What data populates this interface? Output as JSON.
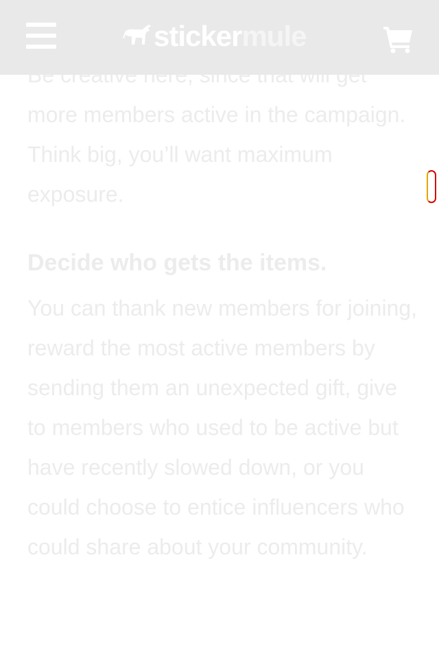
{
  "header": {
    "menu_icon": "hamburger-menu-icon",
    "logo": {
      "word_part1": "sticker",
      "word_part2": "mule",
      "icon": "mule-logo-icon"
    },
    "cart_icon": "shopping-cart-icon"
  },
  "article": {
    "paragraph_1": "Be creative here, since that will get more members active in the campaign. Think big, you’ll want maximum exposure.",
    "heading": "Decide who gets the items.",
    "paragraph_2": "You can thank new members for joining, reward the most active members by sending them an unexpected gift, give to members who used to be active but have recently slowed down, or you could choose to entice influencers who could share about your community."
  },
  "colors": {
    "header_bg": "#e9e9e9",
    "text_faded": "#ececec",
    "icon_white": "#ffffff",
    "scroll_handle_border": "#d60000"
  }
}
